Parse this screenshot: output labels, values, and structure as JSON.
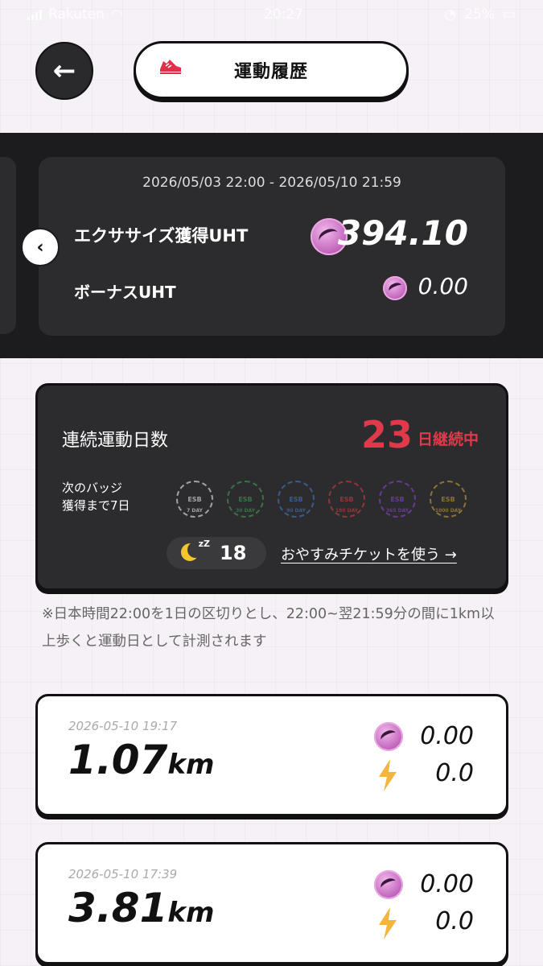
{
  "status_bar": {
    "carrier": "Rakuten",
    "time": "20:27",
    "battery": "25%"
  },
  "header": {
    "title": "運動履歴"
  },
  "summary": {
    "period": "2026/05/03 22:00 - 2026/05/10 21:59",
    "exercise_label": "エクササイズ獲得UHT",
    "exercise_value": "394.10",
    "bonus_label": "ボーナスUHT",
    "bonus_value": "0.00"
  },
  "streak": {
    "title": "連続運動日数",
    "days": "23",
    "days_suffix": "日継続中",
    "next_badge_line1": "次のバッジ",
    "next_badge_line2": "獲得まで7日",
    "badges": [
      {
        "text": "ESB",
        "label": "7 DAY",
        "color": "#c9c9c9"
      },
      {
        "text": "ESB",
        "label": "30 DAY",
        "color": "#3d8a4f"
      },
      {
        "text": "ESB",
        "label": "90 DAY",
        "color": "#3f6aa8"
      },
      {
        "text": "ESB",
        "label": "180 DAY",
        "color": "#b03a3a"
      },
      {
        "text": "ESB",
        "label": "365 DAY",
        "color": "#7a3fb0"
      },
      {
        "text": "ESB",
        "label": "1000 DAY",
        "color": "#a78a3a"
      }
    ],
    "ticket_count": "18",
    "ticket_link": "おやすみチケットを使う →"
  },
  "note": "※日本時間22:00を1日の区切りとし、22:00~翌21:59分の間に1km以上歩くと運動日として計測されます",
  "history": [
    {
      "time": "2026-05-10 19:17",
      "distance": "1.07",
      "unit": "km",
      "uht": "0.00",
      "energy": "0.0"
    },
    {
      "time": "2026-05-10 17:39",
      "distance": "3.81",
      "unit": "km",
      "uht": "0.00",
      "energy": "0.0"
    }
  ],
  "colors": {
    "accent_red": "#e03a4a",
    "dark_card": "#2c2c2e",
    "coin_pink": "#c66cc0",
    "bolt_yellow": "#f2b63a"
  }
}
